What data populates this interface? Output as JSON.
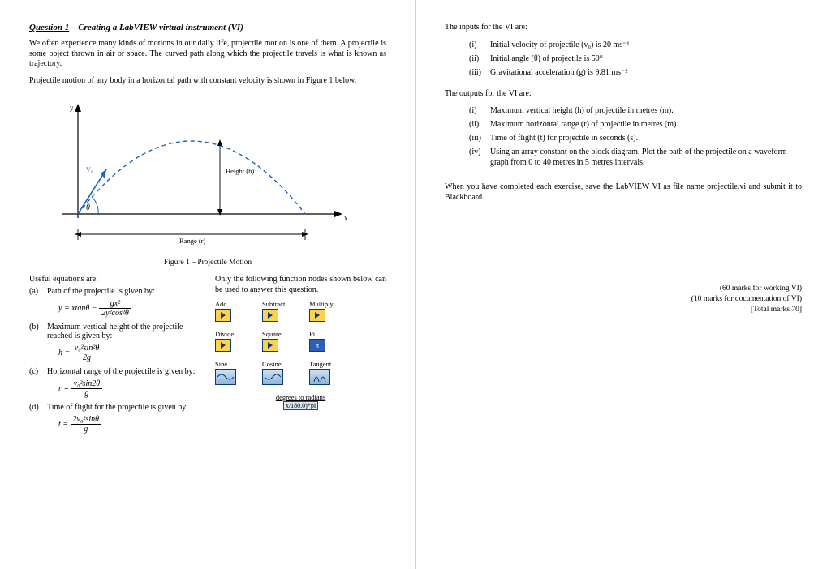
{
  "left": {
    "title_underlined": "Question 1",
    "title_rest": " – Creating a LabVIEW virtual instrument (VI)",
    "para1": "We often experience many kinds of motions in our daily life, projectile motion is one of them. A projectile is some object thrown in air or space. The curved path along which the projectile travels is what is known as trajectory.",
    "para2": "Projectile motion of any body in a horizontal path with constant velocity is shown in Figure 1 below.",
    "fig_y": "y",
    "fig_x": "x",
    "fig_v0": "V₀",
    "fig_theta": "θ",
    "fig_height": "Height (h)",
    "fig_range": "Range (r)",
    "fig_caption": "Figure 1 – Projectile Motion",
    "useful_head": "Useful equations are:",
    "a_marker": "(a)",
    "a_text": "Path of the projectile is given by:",
    "a_eqn_lhs": "y = xtanθ −",
    "a_eqn_num": "gx²",
    "a_eqn_den": "2y²cos²θ",
    "b_marker": "(b)",
    "b_text": "Maximum vertical height of the projectile reached is given by:",
    "b_eqn_lhs": "h =",
    "b_eqn_num": "v₀²sin²θ",
    "b_eqn_den": "2g",
    "c_marker": "(c)",
    "c_text": "Horizontal range of the projectile is given by:",
    "c_eqn_lhs": "r =",
    "c_eqn_num": "v₀²sin2θ",
    "c_eqn_den": "g",
    "d_marker": "(d)",
    "d_text": "Time of flight for the projectile is given by:",
    "d_eqn_lhs": "t =",
    "d_eqn_num": "2v₀²sinθ",
    "d_eqn_den": "g",
    "only_head": "Only the following function nodes shown below can be used to answer this question.",
    "funcs": {
      "add": "Add",
      "subtract": "Subtract",
      "multiply": "Multiply",
      "divide": "Divide",
      "square": "Square",
      "pi": "Pi",
      "sine": "Sine",
      "cosine": "Cosine",
      "tangent": "Tangent",
      "deg2rad": "degrees to radians",
      "deg2rad_body": "x/180.0)*pi"
    }
  },
  "right": {
    "inputs_head": "The inputs for the VI are:",
    "inputs": {
      "i_marker": "(i)",
      "i_text": "Initial velocity of projectile (v₀) is 20 ms⁻¹",
      "ii_marker": "(ii)",
      "ii_text": "Initial angle (θ) of projectile is 50°",
      "iii_marker": "(iii)",
      "iii_text": "Gravitational acceleration (g) is 9.81 ms⁻²"
    },
    "outputs_head": "The outputs for the VI are:",
    "outputs": {
      "i_marker": "(i)",
      "i_text": "Maximum vertical height (h) of projectile in metres (m).",
      "ii_marker": "(ii)",
      "ii_text": "Maximum horizontal range (r) of projectile in metres (m).",
      "iii_marker": "(iii)",
      "iii_text": "Time of flight (t) for projectile in seconds (s).",
      "iv_marker": "(iv)",
      "iv_text": "Using an array constant on the block diagram.  Plot the path of the projectile on a waveform graph from 0 to 40 metres in 5 metres intervals."
    },
    "submit_para": "When you have completed each exercise, save the LabVIEW VI as file name projectile.vi and submit it to Blackboard.",
    "marks1": "(60 marks for working VI)",
    "marks2": "(10 marks for documentation of VI)",
    "marks3": "[Total marks 70]"
  }
}
